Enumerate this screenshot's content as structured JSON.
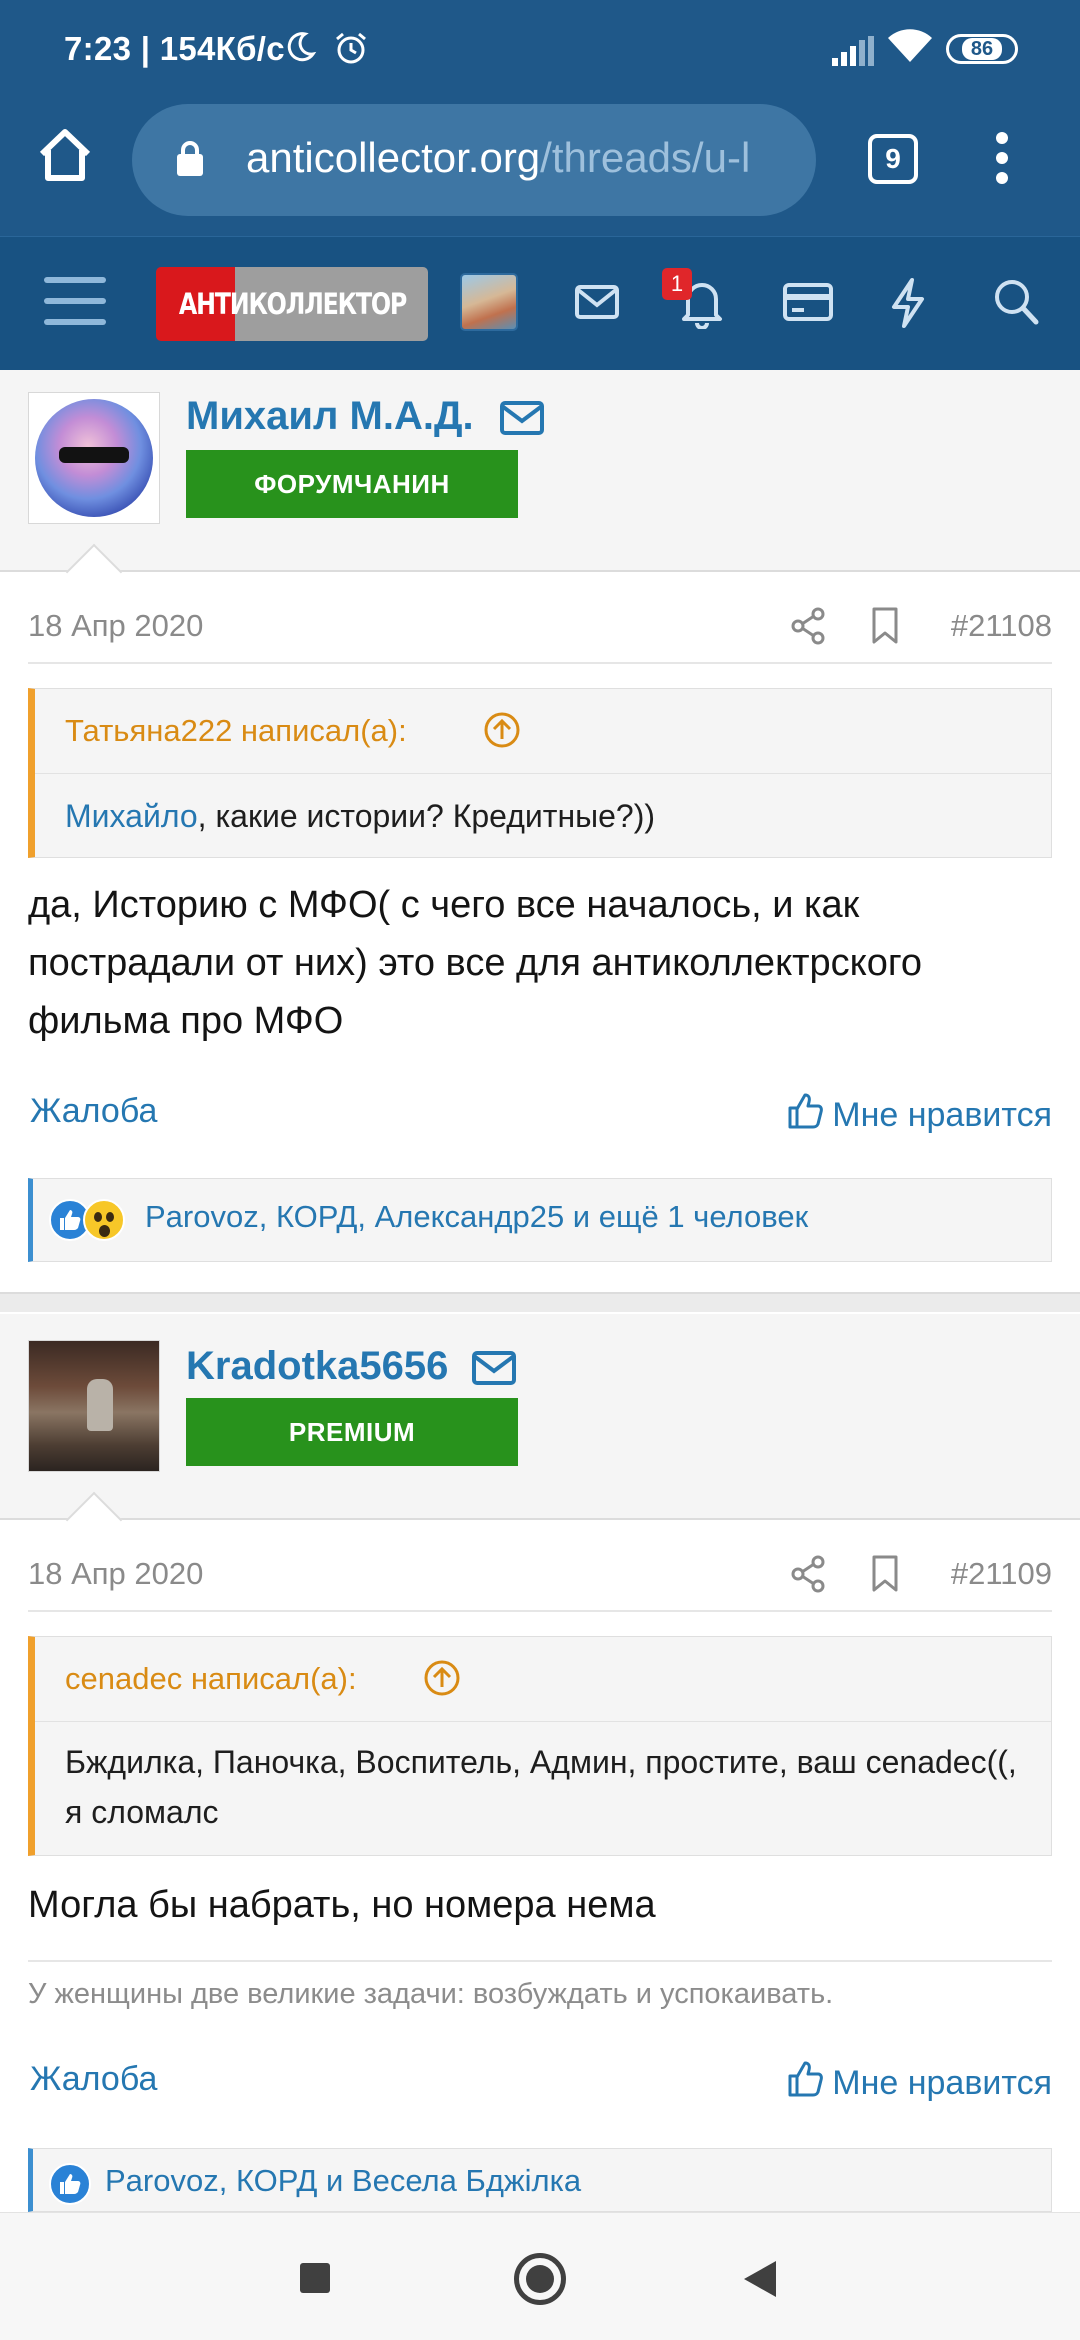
{
  "status_bar": {
    "time": "7:23 | 154Кб/с",
    "battery": "86"
  },
  "browser": {
    "url_domain": "anticollector.org",
    "url_path": "/threads/u-l",
    "tab_count": "9"
  },
  "site_header": {
    "logo_text": "АНТИКОЛЛЕКТОР",
    "notification_badge": "1"
  },
  "posts": [
    {
      "author": "Михаил М.А.Д.",
      "rank": "ФОРУМЧАНИН",
      "date": "18 Апр 2020",
      "post_number": "#21108",
      "quote": {
        "header": "Татьяна222 написал(а):",
        "mention": "Михайло",
        "text": ", какие истории? Кредитные?))"
      },
      "text": "да, Историю с МФО( с чего все началось, и как пострадали от них) это все для антиколлектрского фильма про МФО",
      "report_label": "Жалоба",
      "like_label": "Мне нравится",
      "reactions_text": "Parovoz, КОРД, Александр25 и ещё 1 человек"
    },
    {
      "author": "Kradotka5656",
      "rank": "PREMIUM",
      "date": "18 Апр 2020",
      "post_number": "#21109",
      "quote": {
        "header": "cenadec написал(а):",
        "text": "Бждилка, Паночка, Воспитель, Админ, простите, ваш cenadec((, я сломалс"
      },
      "text": "Могла бы набрать, но номера нема",
      "signature": "У женщины две великие задачи: возбуждать и успокаивать.",
      "report_label": "Жалоба",
      "like_label": "Мне нравится",
      "reactions_text": "Parovoz, КОРД и Весела Бджілка"
    }
  ],
  "colors": {
    "header_blue": "#1f5889",
    "link_blue": "#2577b1",
    "rank_green": "#28921c",
    "quote_orange": "#f0a02c"
  }
}
